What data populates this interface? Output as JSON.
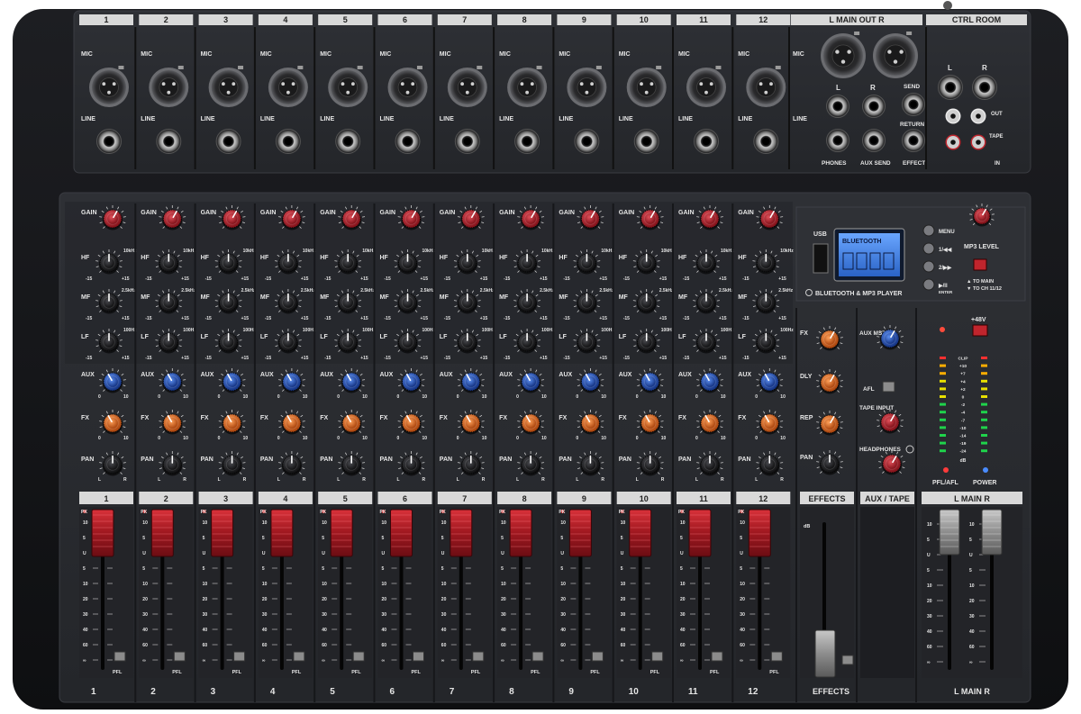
{
  "channels": [
    "1",
    "2",
    "3",
    "4",
    "5",
    "6",
    "7",
    "8",
    "9",
    "10",
    "11",
    "12"
  ],
  "io": {
    "mic": "MIC",
    "line": "LINE",
    "main_out": "L  MAIN OUT  R",
    "ctrl_room": "CTRL ROOM",
    "l": "L",
    "r": "R",
    "phones": "PHONES",
    "aux_send": "AUX SEND",
    "send": "SEND",
    "return": "RETURN",
    "effect": "EFFECT",
    "out": "OUT",
    "tape": "TAPE",
    "in": "IN"
  },
  "strip": {
    "gain": "GAIN",
    "hf": "HF",
    "mf": "MF",
    "lf": "LF",
    "aux": "AUX",
    "fx": "FX",
    "pan": "PAN",
    "hf_freq": "10kHz",
    "mf_freq": "2.5kHz",
    "lf_freq": "100Hz",
    "eq_min": "-15",
    "eq_max": "+15",
    "zero": "0",
    "ten": "10",
    "pan_l": "L",
    "pan_r": "R",
    "pk": "PK",
    "u": "U",
    "pfl": "PFL",
    "scale": [
      "10",
      "5",
      "U",
      "5",
      "10",
      "20",
      "30",
      "40",
      "60",
      "∞"
    ]
  },
  "mp3": {
    "usb": "USB",
    "display": "BLUETOOTH",
    "menu": "MENU",
    "b2": "1/◀◀",
    "b3": "2/▶▶",
    "b4": "▶/II",
    "enter": "ENTER",
    "level": "MP3 LEVEL",
    "to_main": "▲ TO MAIN",
    "to_ch": "▼ TO CH 11/12",
    "title": "BLUETOOTH & MP3 PLAYER"
  },
  "effects": {
    "fx": "FX",
    "dly": "DLY",
    "rep": "REP",
    "pan": "PAN",
    "label": "EFFECTS",
    "db": "dB",
    "bottom": "EFFECTS"
  },
  "auxtape": {
    "aux_mst": "AUX MST",
    "afl": "AFL",
    "tape_input": "TAPE INPUT",
    "headphones": "HEADPHONES",
    "label": "AUX / TAPE"
  },
  "master": {
    "p48": "+48V",
    "meter": [
      "CLIP",
      "+10",
      "+7",
      "+4",
      "+2",
      "0",
      "-2",
      "-4",
      "-7",
      "-10",
      "-14",
      "-19",
      "-24"
    ],
    "db": "dB",
    "pfl_afl": "PFL/AFL",
    "power": "POWER",
    "label": "L  MAIN  R",
    "bottom": "L  MAIN  R"
  },
  "colors": {
    "chassis": "#141518",
    "panel": "#2a2c31",
    "gain_knob": "#b81f2a",
    "aux_knob": "#1f55c9",
    "fx_knob": "#e6641b",
    "fader_cap": "#b5202a",
    "master_cap": "#9a9a9a",
    "power_led": "#4a8cff",
    "pfl_led": "#ff3b3b",
    "lcd": "#3a7bd8"
  }
}
